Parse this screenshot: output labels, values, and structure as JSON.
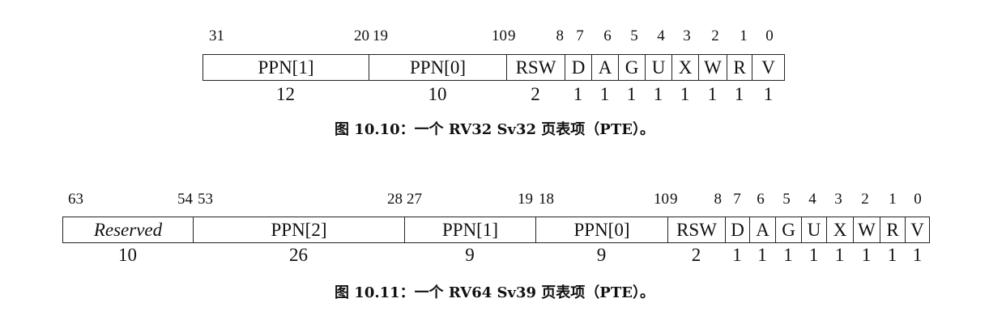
{
  "figures": [
    {
      "caption": "图 10.10：一个 RV32 Sv32 页表项（PTE）。",
      "bit_labels": [
        "31",
        "20",
        "19",
        "10",
        "9",
        "8",
        "7",
        "6",
        "5",
        "4",
        "3",
        "2",
        "1",
        "0"
      ],
      "fields": [
        {
          "name": "PPN[1]",
          "width": "12"
        },
        {
          "name": "PPN[0]",
          "width": "10"
        },
        {
          "name": "RSW",
          "width": "2"
        },
        {
          "name": "D",
          "width": "1"
        },
        {
          "name": "A",
          "width": "1"
        },
        {
          "name": "G",
          "width": "1"
        },
        {
          "name": "U",
          "width": "1"
        },
        {
          "name": "X",
          "width": "1"
        },
        {
          "name": "W",
          "width": "1"
        },
        {
          "name": "R",
          "width": "1"
        },
        {
          "name": "V",
          "width": "1"
        }
      ]
    },
    {
      "caption": "图 10.11：一个 RV64 Sv39 页表项（PTE）。",
      "bit_labels": [
        "63",
        "54",
        "53",
        "28",
        "27",
        "19",
        "18",
        "10",
        "9",
        "8",
        "7",
        "6",
        "5",
        "4",
        "3",
        "2",
        "1",
        "0"
      ],
      "fields": [
        {
          "name": "Reserved",
          "width": "10"
        },
        {
          "name": "PPN[2]",
          "width": "26"
        },
        {
          "name": "PPN[1]",
          "width": "9"
        },
        {
          "name": "PPN[0]",
          "width": "9"
        },
        {
          "name": "RSW",
          "width": "2"
        },
        {
          "name": "D",
          "width": "1"
        },
        {
          "name": "A",
          "width": "1"
        },
        {
          "name": "G",
          "width": "1"
        },
        {
          "name": "U",
          "width": "1"
        },
        {
          "name": "X",
          "width": "1"
        },
        {
          "name": "W",
          "width": "1"
        },
        {
          "name": "R",
          "width": "1"
        },
        {
          "name": "V",
          "width": "1"
        }
      ]
    }
  ]
}
